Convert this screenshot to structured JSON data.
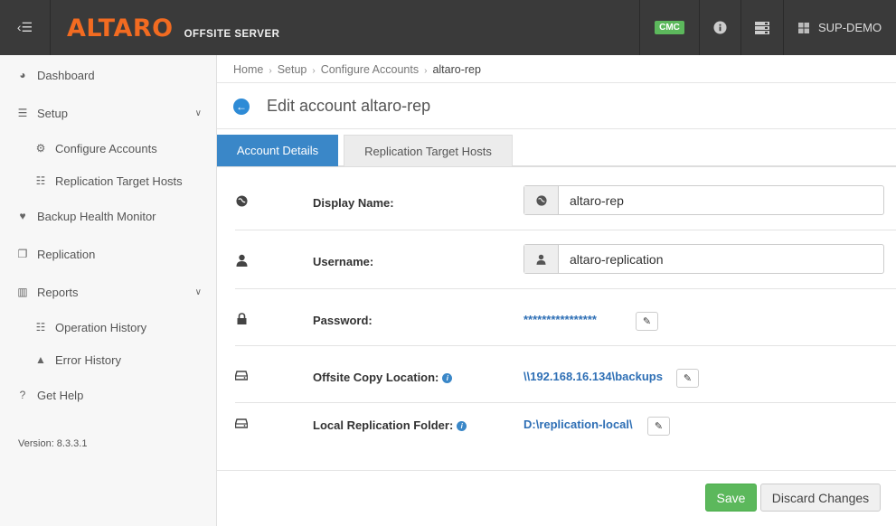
{
  "topbar": {
    "logo": "ALTARO",
    "subtitle": "OFFSITE SERVER",
    "cmc_badge": "CMC",
    "user": "SUP-DEMO"
  },
  "sidebar": {
    "items": [
      {
        "label": "Dashboard",
        "icon": "dashboard-icon"
      },
      {
        "label": "Setup",
        "icon": "sliders-icon",
        "expanded": true
      },
      {
        "label": "Configure Accounts",
        "icon": "gear-icon"
      },
      {
        "label": "Replication Target Hosts",
        "icon": "list-icon"
      },
      {
        "label": "Backup Health Monitor",
        "icon": "heartbeat-icon"
      },
      {
        "label": "Replication",
        "icon": "copy-icon"
      },
      {
        "label": "Reports",
        "icon": "bar-chart-icon",
        "expanded": true
      },
      {
        "label": "Operation History",
        "icon": "list-icon"
      },
      {
        "label": "Error History",
        "icon": "warning-icon"
      },
      {
        "label": "Get Help",
        "icon": "question-icon"
      }
    ],
    "version": "Version: 8.3.3.1"
  },
  "breadcrumb": [
    "Home",
    "Setup",
    "Configure Accounts",
    "altaro-rep"
  ],
  "page_title": "Edit account altaro-rep",
  "tabs": [
    {
      "label": "Account Details",
      "active": true
    },
    {
      "label": "Replication Target Hosts",
      "active": false
    }
  ],
  "form": {
    "display_name": {
      "label": "Display Name:",
      "value": "altaro-rep"
    },
    "username": {
      "label": "Username:",
      "value": "altaro-replication"
    },
    "password": {
      "label": "Password:",
      "value": "****************"
    },
    "offsite_copy": {
      "label": "Offsite Copy Location:",
      "value": "\\\\192.168.16.134\\backups"
    },
    "local_replication": {
      "label": "Local Replication Folder:",
      "value": "D:\\replication-local\\"
    }
  },
  "buttons": {
    "save": "Save",
    "discard": "Discard Changes"
  },
  "colors": {
    "accent": "#3a87c8",
    "brand": "#f26b21",
    "success": "#5cb85c",
    "topbar": "#3a3a3a"
  }
}
